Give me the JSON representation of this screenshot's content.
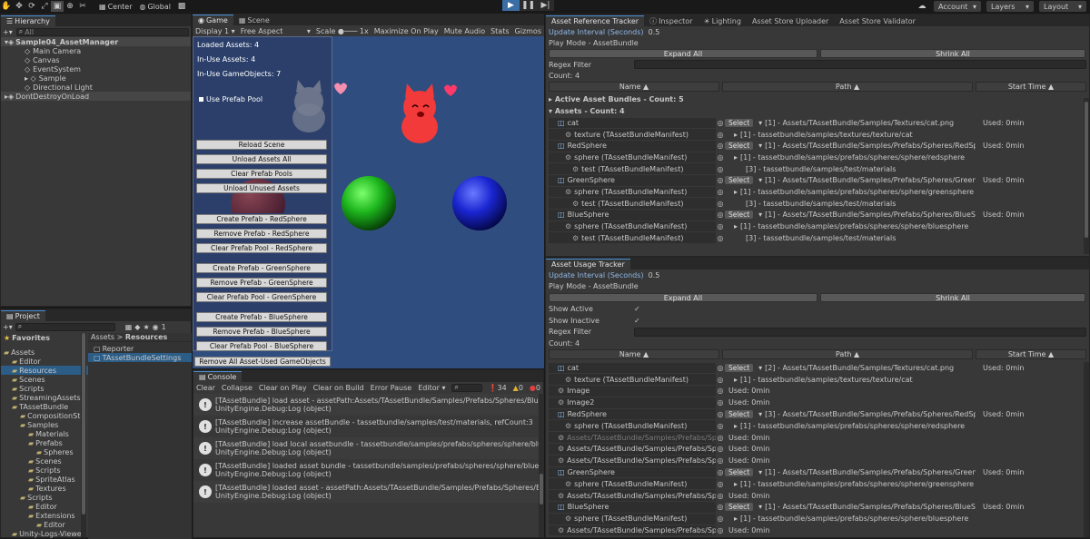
{
  "toolbar": {
    "center_label": "Center",
    "global_label": "Global",
    "account": "Account",
    "layers": "Layers",
    "layout": "Layout"
  },
  "hierarchy": {
    "tab": "Hierarchy",
    "search_placeholder": "All",
    "scene": "Sample04_AssetManager",
    "items": [
      "Main Camera",
      "Canvas",
      "EventSystem",
      "Sample",
      "Directional Light"
    ],
    "dontdestroy": "DontDestroyOnLoad"
  },
  "game": {
    "tab_game": "Game",
    "tab_scene": "Scene",
    "display": "Display 1",
    "aspect": "Free Aspect",
    "scale_label": "Scale",
    "scale_value": "1x",
    "maximize": "Maximize On Play",
    "mute": "Mute Audio",
    "stats": "Stats",
    "gizmos": "Gizmos",
    "loaded_assets": "Loaded Assets: 4",
    "inuse_assets": "In-Use Assets: 4",
    "inuse_go": "In-Use GameObjects: 7",
    "use_prefab_pool": "Use Prefab Pool",
    "buttons": [
      "Reload Scene",
      "Unload Assets All",
      "Clear Prefab Pools",
      "Unload Unused Assets",
      "Create Prefab - RedSphere",
      "Remove Prefab - RedSphere",
      "Clear Prefab Pool - RedSphere",
      "Create Prefab - GreenSphere",
      "Remove Prefab - GreenSphere",
      "Clear Prefab Pool - GreenSphere",
      "Create Prefab - BlueSphere",
      "Remove Prefab - BlueSphere",
      "Clear Prefab Pool - BlueSphere",
      "Remove All Asset-Used GameObjects"
    ]
  },
  "project": {
    "tab": "Project",
    "search_placeholder": "",
    "count": "1",
    "favorites": "Favorites",
    "tree": [
      {
        "label": "Assets",
        "indent": 0
      },
      {
        "label": "Editor",
        "indent": 1
      },
      {
        "label": "Resources",
        "indent": 1
      },
      {
        "label": "Scenes",
        "indent": 1
      },
      {
        "label": "Scripts",
        "indent": 1
      },
      {
        "label": "StreamingAssets",
        "indent": 1
      },
      {
        "label": "TAssetBundle",
        "indent": 1
      },
      {
        "label": "CompositionStr",
        "indent": 2
      },
      {
        "label": "Samples",
        "indent": 2
      },
      {
        "label": "Materials",
        "indent": 3
      },
      {
        "label": "Prefabs",
        "indent": 3
      },
      {
        "label": "Spheres",
        "indent": 4
      },
      {
        "label": "Scenes",
        "indent": 3
      },
      {
        "label": "Scripts",
        "indent": 3
      },
      {
        "label": "SpriteAtlas",
        "indent": 3
      },
      {
        "label": "Textures",
        "indent": 3
      },
      {
        "label": "Scripts",
        "indent": 2
      },
      {
        "label": "Editor",
        "indent": 3
      },
      {
        "label": "Extensions",
        "indent": 3
      },
      {
        "label": "Editor",
        "indent": 4
      },
      {
        "label": "Unity-Logs-Viewer",
        "indent": 1
      }
    ],
    "breadcrumb_root": "Assets",
    "breadcrumb_sep": ">",
    "breadcrumb_current": "Resources",
    "files": [
      "Reporter",
      "TAssetBundleSettings"
    ]
  },
  "console": {
    "tab": "Console",
    "clear": "Clear",
    "collapse": "Collapse",
    "clear_on_play": "Clear on Play",
    "clear_on_build": "Clear on Build",
    "error_pause": "Error Pause",
    "editor": "Editor",
    "count": "34",
    "count2": "0",
    "count3": "0",
    "entries": [
      {
        "line1": "[TAssetBundle] load asset - assetPath:Assets/TAssetBundle/Samples/Prefabs/Spheres/BlueSphere.p",
        "line2": "UnityEngine.Debug:Log (object)"
      },
      {
        "line1": "[TAssetBundle] increase assetBundle - tassetbundle/samples/test/materials, refCount:3",
        "line2": "UnityEngine.Debug:Log (object)"
      },
      {
        "line1": "[TAssetBundle] load local assetbundle - tassetbundle/samples/prefabs/spheres/sphere/bluesphere",
        "line2": "UnityEngine.Debug:Log (object)"
      },
      {
        "line1": "[TAssetBundle] loaded asset bundle - tassetbundle/samples/prefabs/spheres/sphere/bluesphere",
        "line2": "UnityEngine.Debug:Log (object)"
      },
      {
        "line1": "[TAssetBundle] loaded asset - assetPath:Assets/TAssetBundle/Samples/Prefabs/Spheres/BlueSpher",
        "line2": "UnityEngine.Debug:Log (object)"
      }
    ]
  },
  "art": {
    "tracker_tab": "Asset Reference Tracker",
    "inspector_tab": "Inspector",
    "lighting_tab": "Lighting",
    "uploader_tab": "Asset Store Uploader",
    "validator_tab": "Asset Store Validator",
    "update_interval_label": "Update Interval (Seconds)",
    "update_interval_value": "0.5",
    "play_mode": "Play Mode - AssetBundle",
    "expand_all": "Expand All",
    "shrink_all": "Shrink All",
    "regex_filter": "Regex Filter",
    "count": "Count: 4",
    "col_name": "Name ▲",
    "col_path": "Path ▲",
    "col_start": "Start Time ▲",
    "active_bundles": "Active Asset Bundles - Count: 5",
    "assets_count": "Assets - Count: 4",
    "select": "Select",
    "rows": [
      {
        "name": "cat",
        "path": "[1] - Assets/TAssetBundle/Samples/Textures/cat.png",
        "time": "Used: 0min",
        "kind": "asset"
      },
      {
        "name": "texture (TAssetBundleManifest)",
        "path": "[1] - tassetbundle/samples/textures/texture/cat",
        "time": "",
        "kind": "sub"
      },
      {
        "name": "RedSphere",
        "path": "[1] - Assets/TAssetBundle/Samples/Prefabs/Spheres/RedSphere.prefab",
        "time": "Used: 0min",
        "kind": "asset"
      },
      {
        "name": "sphere (TAssetBundleManifest)",
        "path": "[1] - tassetbundle/samples/prefabs/spheres/sphere/redsphere",
        "time": "",
        "kind": "sub"
      },
      {
        "name": "test (TAssetBundleManifest)",
        "path": "[3] - tassetbundle/samples/test/materials",
        "time": "",
        "kind": "sub2"
      },
      {
        "name": "GreenSphere",
        "path": "[1] - Assets/TAssetBundle/Samples/Prefabs/Spheres/GreenSphere.prefab",
        "time": "Used: 0min",
        "kind": "asset"
      },
      {
        "name": "sphere (TAssetBundleManifest)",
        "path": "[1] - tassetbundle/samples/prefabs/spheres/sphere/greensphere",
        "time": "",
        "kind": "sub"
      },
      {
        "name": "test (TAssetBundleManifest)",
        "path": "[3] - tassetbundle/samples/test/materials",
        "time": "",
        "kind": "sub2"
      },
      {
        "name": "BlueSphere",
        "path": "[1] - Assets/TAssetBundle/Samples/Prefabs/Spheres/BlueSphere.prefab",
        "time": "Used: 0min",
        "kind": "asset"
      },
      {
        "name": "sphere (TAssetBundleManifest)",
        "path": "[1] - tassetbundle/samples/prefabs/spheres/sphere/bluesphere",
        "time": "",
        "kind": "sub"
      },
      {
        "name": "test (TAssetBundleManifest)",
        "path": "[3] - tassetbundle/samples/test/materials",
        "time": "",
        "kind": "sub2"
      }
    ]
  },
  "aut": {
    "tab": "Asset Usage Tracker",
    "update_interval_label": "Update Interval (Seconds)",
    "update_interval_value": "0.5",
    "play_mode": "Play Mode - AssetBundle",
    "expand_all": "Expand All",
    "shrink_all": "Shrink All",
    "show_active": "Show Active",
    "show_inactive": "Show Inactive",
    "regex_filter": "Regex Filter",
    "count": "Count: 4",
    "col_name": "Name ▲",
    "col_path": "Path ▲",
    "col_start": "Start Time ▲",
    "select": "Select",
    "rows": [
      {
        "name": "cat",
        "path": "[2] - Assets/TAssetBundle/Samples/Textures/cat.png",
        "time": "Used: 0min",
        "kind": "asset"
      },
      {
        "name": "texture (TAssetBundleManifest)",
        "path": "[1] - tassetbundle/samples/textures/texture/cat",
        "time": "",
        "kind": "sub"
      },
      {
        "name": "Image",
        "path": "Used: 0min",
        "time": "",
        "kind": "use"
      },
      {
        "name": "Image2",
        "path": "Used: 0min",
        "time": "",
        "kind": "use"
      },
      {
        "name": "RedSphere",
        "path": "[3] - Assets/TAssetBundle/Samples/Prefabs/Spheres/RedSphere.prefab",
        "time": "Used: 0min",
        "kind": "asset"
      },
      {
        "name": "sphere (TAssetBundleManifest)",
        "path": "[1] - tassetbundle/samples/prefabs/spheres/sphere/redsphere",
        "time": "",
        "kind": "sub"
      },
      {
        "name": "Assets/TAssetBundle/Samples/Prefabs/Sphe",
        "path": "Used: 0min",
        "time": "",
        "kind": "usedim"
      },
      {
        "name": "Assets/TAssetBundle/Samples/Prefabs/Sphe",
        "path": "Used: 0min",
        "time": "",
        "kind": "use"
      },
      {
        "name": "Assets/TAssetBundle/Samples/Prefabs/Sphe",
        "path": "Used: 0min",
        "time": "",
        "kind": "use"
      },
      {
        "name": "GreenSphere",
        "path": "[1] - Assets/TAssetBundle/Samples/Prefabs/Spheres/GreenSphere.prefab",
        "time": "Used: 0min",
        "kind": "asset"
      },
      {
        "name": "sphere (TAssetBundleManifest)",
        "path": "[1] - tassetbundle/samples/prefabs/spheres/sphere/greensphere",
        "time": "",
        "kind": "sub"
      },
      {
        "name": "Assets/TAssetBundle/Samples/Prefabs/Sphe",
        "path": "Used: 0min",
        "time": "",
        "kind": "use"
      },
      {
        "name": "BlueSphere",
        "path": "[1] - Assets/TAssetBundle/Samples/Prefabs/Spheres/BlueSphere.prefab",
        "time": "Used: 0min",
        "kind": "asset"
      },
      {
        "name": "sphere (TAssetBundleManifest)",
        "path": "[1] - tassetbundle/samples/prefabs/spheres/sphere/bluesphere",
        "time": "",
        "kind": "sub"
      },
      {
        "name": "Assets/TAssetBundle/Samples/Prefabs/Sphe",
        "path": "Used: 0min",
        "time": "",
        "kind": "use"
      }
    ]
  },
  "colors": {
    "accent": "#4a90d9",
    "game_bg": "#2f4d7e",
    "red": "#d42020",
    "green": "#1ea020",
    "blue": "#1a2ad0"
  }
}
